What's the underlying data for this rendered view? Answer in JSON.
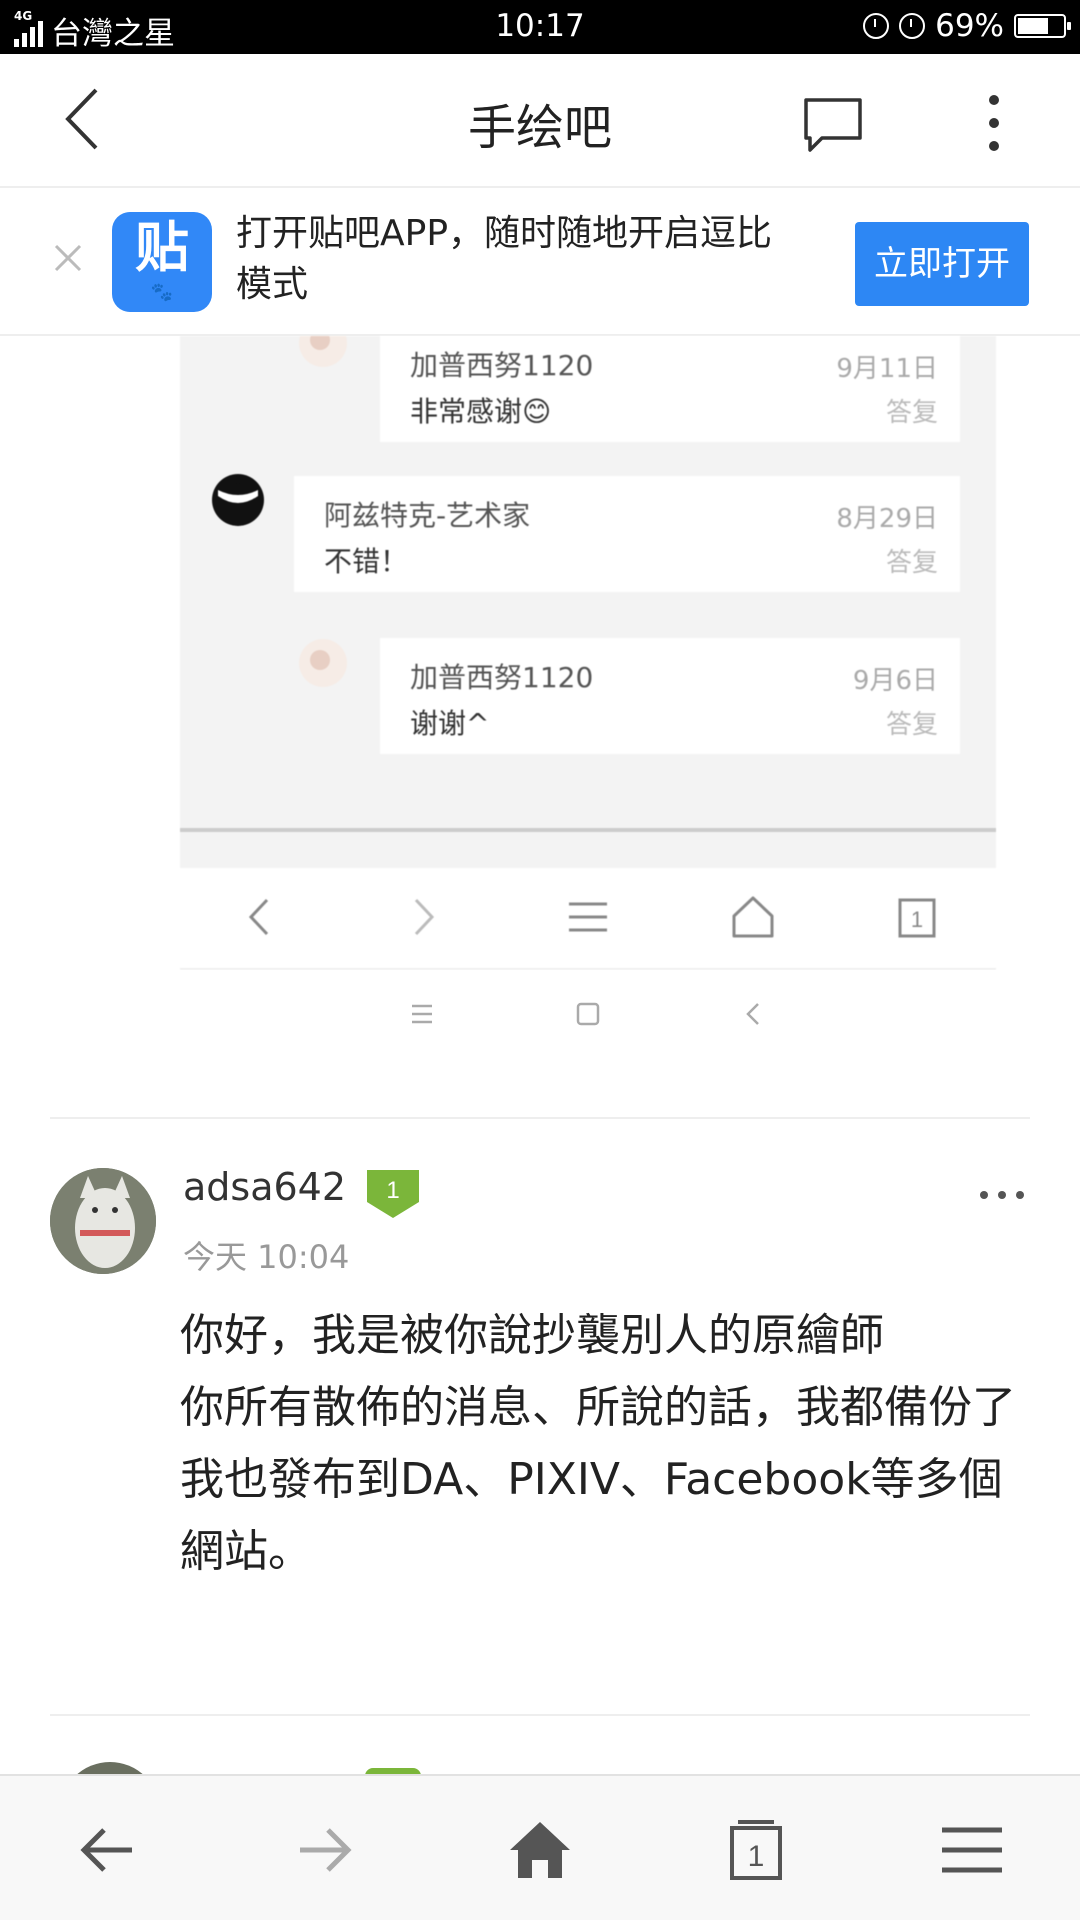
{
  "status_bar": {
    "network_label": "4G",
    "carrier": "台灣之星",
    "time": "10:17",
    "battery_text": "69%",
    "battery_level": 0.69,
    "icons": [
      "signal-icon",
      "lock-rotation-icon",
      "alarm-icon",
      "battery-icon"
    ]
  },
  "header": {
    "title": "手绘吧",
    "icons": [
      "back-arrow-icon",
      "message-icon",
      "more-vertical-icon"
    ]
  },
  "app_banner": {
    "logo_glyph": "贴",
    "logo_paw": "🐾",
    "text": "打开贴吧APP，随时随地开启逗比模式",
    "open_button": "立即打开",
    "close_icon": "close-icon"
  },
  "embedded_image": {
    "replies": [
      {
        "name": "加普西努1120",
        "text": "非常感谢😊",
        "date": "9月11日",
        "reply": "答复"
      },
      {
        "name": "阿兹特克-艺术家",
        "text": "不错！",
        "date": "8月29日",
        "reply": "答复"
      },
      {
        "name": "加普西努1120",
        "text": "谢谢^",
        "date": "9月6日",
        "reply": "答复"
      }
    ],
    "browser_nav_icons": [
      "back-icon",
      "forward-icon",
      "menu-icon",
      "home-icon",
      "tabs-icon"
    ],
    "tabs_count": "1",
    "system_nav_icons": [
      "menu-icon",
      "square-icon",
      "back-icon"
    ]
  },
  "post": {
    "username": "adsa642",
    "level": "1",
    "time": "今天 10:04",
    "body_lines": [
      "你好，我是被你說抄襲別人的原繪師",
      "你所有散佈的消息、所說的話，我都備份了",
      "我也發布到DA、PIXIV、Facebook等多個網站。"
    ],
    "more_icon": "more-horizontal-icon"
  },
  "bottom_bar": {
    "icons": [
      "back-arrow-icon",
      "forward-arrow-icon",
      "home-icon",
      "tabs-icon",
      "menu-icon"
    ],
    "tabs_count": "1"
  },
  "colors": {
    "accent_blue": "#2d87f4",
    "level_green": "#7bb63a",
    "status_bar": "#000000"
  }
}
